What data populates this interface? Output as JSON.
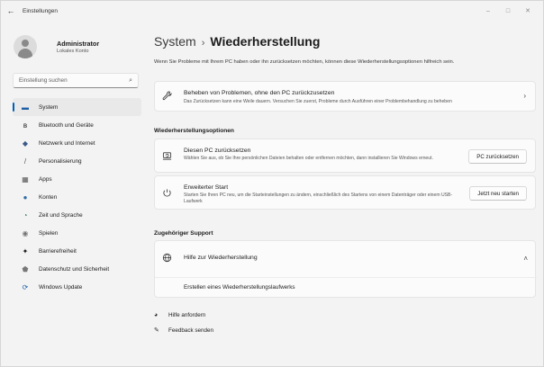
{
  "window": {
    "title": "Einstellungen",
    "back_glyph": "←",
    "controls": {
      "minimize": "–",
      "maximize": "□",
      "close": "✕"
    }
  },
  "profile": {
    "name": "Administrator",
    "account_type": "Lokales Konto"
  },
  "search": {
    "placeholder": "Einstellung suchen",
    "icon": "search-icon"
  },
  "nav": {
    "active_index": 0,
    "items": [
      {
        "label": "System",
        "icon": "system-icon",
        "glyph": "▬",
        "color": "#1f5fa8"
      },
      {
        "label": "Bluetooth und Geräte",
        "icon": "bluetooth-icon",
        "glyph": "ʙ",
        "color": "#1b1b1b"
      },
      {
        "label": "Netzwerk und Internet",
        "icon": "wifi-icon",
        "glyph": "◆",
        "color": "#3a5a8a"
      },
      {
        "label": "Personalisierung",
        "icon": "brush-icon",
        "glyph": "/",
        "color": "#555555"
      },
      {
        "label": "Apps",
        "icon": "apps-icon",
        "glyph": "▦",
        "color": "#555555"
      },
      {
        "label": "Konten",
        "icon": "accounts-icon",
        "glyph": "●",
        "color": "#2b6aa6"
      },
      {
        "label": "Zeit und Sprache",
        "icon": "globe-clock-icon",
        "glyph": "◔",
        "color": "#2f7d4f"
      },
      {
        "label": "Spielen",
        "icon": "gamepad-icon",
        "glyph": "◉",
        "color": "#777777"
      },
      {
        "label": "Barrierefreiheit",
        "icon": "accessibility-icon",
        "glyph": "✦",
        "color": "#1b1b1b"
      },
      {
        "label": "Datenschutz und Sicherheit",
        "icon": "shield-icon",
        "glyph": "⬟",
        "color": "#777777"
      },
      {
        "label": "Windows Update",
        "icon": "update-icon",
        "glyph": "⟳",
        "color": "#1f5fa8"
      }
    ]
  },
  "main": {
    "breadcrumb_parent": "System",
    "breadcrumb_separator": "›",
    "page_title": "Wiederherstellung",
    "intro": "Wenn Sie Probleme mit Ihrem PC haben oder ihn zurücksetzen möchten, können diese Wiederherstellungsoptionen hilfreich sein.",
    "fix_card": {
      "icon": "wrench-icon",
      "glyph": "🔧",
      "title": "Beheben von Problemen, ohne den PC zurückzusetzen",
      "description": "Das Zurücksetzen kann eine Weile dauern. Versuchen Sie zuerst, Probleme durch Ausführen einer Problembehandlung zu beheben",
      "chevron": "›"
    },
    "options_header": "Wiederherstellungsoptionen",
    "reset_card": {
      "icon": "reset-pc-icon",
      "glyph": "⌂",
      "title": "Diesen PC zurücksetzen",
      "description": "Wählen Sie aus, ob Sie Ihre persönlichen Dateien behalten oder entfernen möchten, dann installieren Sie Windows erneut.",
      "button": "PC zurücksetzen"
    },
    "advanced_card": {
      "icon": "restart-icon",
      "glyph": "↻",
      "title": "Erweiterter Start",
      "description": "Starten Sie Ihren PC neu, um die Starteinstellungen zu ändern, einschließlich des Startens von einem Datenträger oder einem USB-Laufwerk",
      "button": "Jetzt neu starten"
    },
    "support_header": "Zugehöriger Support",
    "support_card": {
      "icon": "globe-icon",
      "glyph": "⊕",
      "title": "Hilfe zur Wiederherstellung",
      "chevron": "˄",
      "link": "Erstellen eines Wiederherstellungslaufwerks"
    },
    "footer": {
      "help": {
        "label": "Hilfe anfordern",
        "icon": "help-icon",
        "glyph": "◕"
      },
      "feedback": {
        "label": "Feedback senden",
        "icon": "feedback-icon",
        "glyph": "✎"
      }
    }
  }
}
